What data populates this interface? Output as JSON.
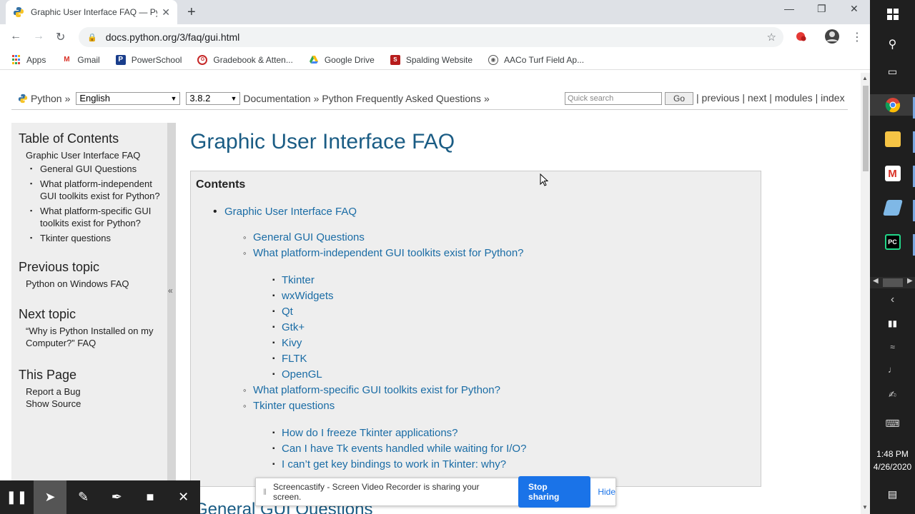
{
  "browser": {
    "tab_title": "Graphic User Interface FAQ — Py",
    "tab_close": "✕",
    "new_tab": "+",
    "url": "docs.python.org/3/faq/gui.html",
    "window_controls": {
      "minimize": "—",
      "restore": "❐",
      "close": "✕"
    },
    "bookmarks": [
      {
        "label": "Apps",
        "icon": "apps-grid-icon",
        "color": "#4285f4"
      },
      {
        "label": "Gmail",
        "icon": "gmail-icon",
        "color": "#d93025"
      },
      {
        "label": "PowerSchool",
        "icon": "powerschool-icon",
        "color": "#1a3e8c"
      },
      {
        "label": "Gradebook & Atten...",
        "icon": "gradebook-icon",
        "color": "#c62828"
      },
      {
        "label": "Google Drive",
        "icon": "google-drive-icon",
        "color": "#34a853"
      },
      {
        "label": "Spalding Website",
        "icon": "spalding-icon",
        "color": "#b71c1c"
      },
      {
        "label": "AACo Turf Field Ap...",
        "icon": "globe-icon",
        "color": "#555555"
      }
    ]
  },
  "related": {
    "python_label": "Python",
    "separator": "»",
    "language": "English",
    "version": "3.8.2",
    "breadcrumb": [
      "Documentation",
      "Python Frequently Asked Questions"
    ],
    "search_placeholder": "Quick search",
    "go_label": "Go",
    "nav_links": [
      "previous",
      "next",
      "modules",
      "index"
    ]
  },
  "sidebar": {
    "toc_heading": "Table of Contents",
    "toc_root": "Graphic User Interface FAQ",
    "toc_items": [
      "General GUI Questions",
      "What platform-independent GUI toolkits exist for Python?",
      "What platform-specific GUI toolkits exist for Python?",
      "Tkinter questions"
    ],
    "prev_heading": "Previous topic",
    "prev_link": "Python on Windows FAQ",
    "next_heading": "Next topic",
    "next_link": "“Why is Python Installed on my Computer?” FAQ",
    "page_heading": "This Page",
    "page_links": [
      "Report a Bug",
      "Show Source"
    ],
    "collapse_glyph": "«"
  },
  "main": {
    "title": "Graphic User Interface FAQ",
    "contents_heading": "Contents",
    "root_link": "Graphic User Interface FAQ",
    "sections": [
      {
        "label": "General GUI Questions",
        "children": []
      },
      {
        "label": "What platform-independent GUI toolkits exist for Python?",
        "children": [
          "Tkinter",
          "wxWidgets",
          "Qt",
          "Gtk+",
          "Kivy",
          "FLTK",
          "OpenGL"
        ]
      },
      {
        "label": "What platform-specific GUI toolkits exist for Python?",
        "children": []
      },
      {
        "label": "Tkinter questions",
        "children": [
          "How do I freeze Tkinter applications?",
          "Can I have Tk events handled while waiting for I/O?",
          "I can’t get key bindings to work in Tkinter: why?"
        ]
      }
    ],
    "next_section_heading": "General GUI Questions"
  },
  "screencastify": {
    "message": "Screencastify - Screen Video Recorder is sharing your screen.",
    "stop_label": "Stop sharing",
    "hide_label": "Hide"
  },
  "taskbar": {
    "time": "1:48 PM",
    "date": "4/26/2020"
  }
}
